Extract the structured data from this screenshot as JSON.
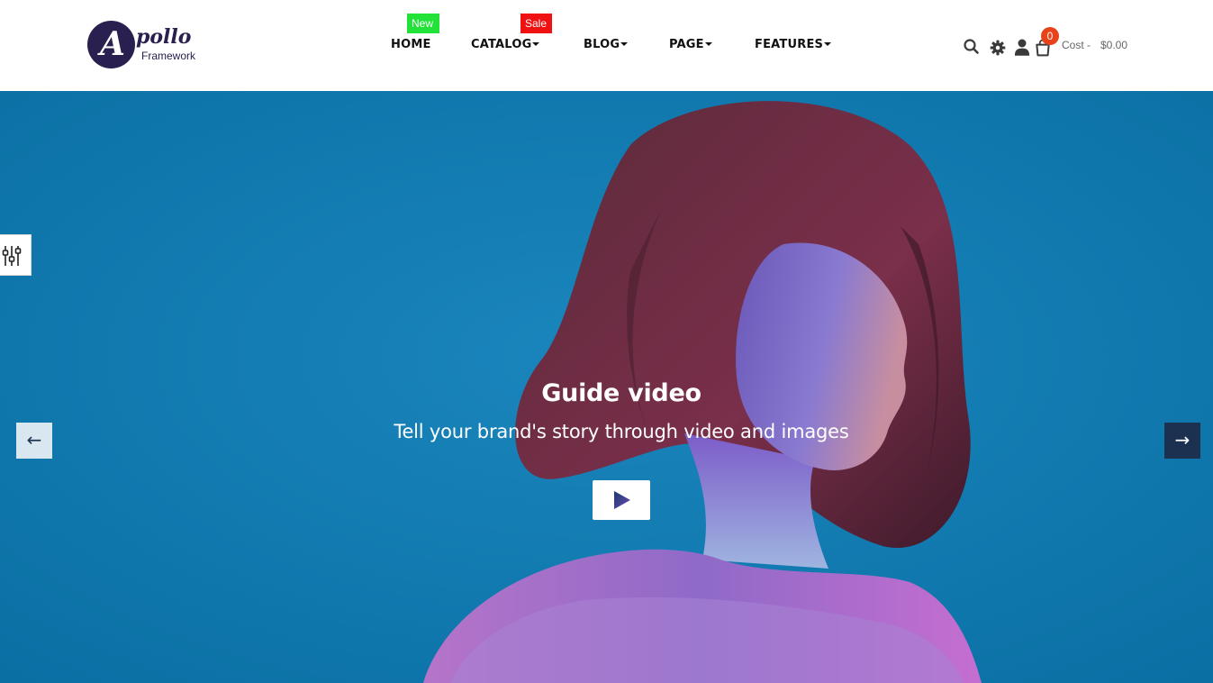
{
  "brand": {
    "logo_initial": "A",
    "logo_word": "pollo",
    "logo_sub": "Framework",
    "color": "#2a2050"
  },
  "nav": {
    "items": [
      {
        "label": "HOME",
        "badge": "New",
        "badge_color": "#22e23a",
        "has_dropdown": false
      },
      {
        "label": "CATALOG",
        "badge": "Sale",
        "badge_color": "#ef1111",
        "has_dropdown": true
      },
      {
        "label": "BLOG",
        "has_dropdown": true
      },
      {
        "label": "PAGE",
        "has_dropdown": true
      },
      {
        "label": "FEATURES",
        "has_dropdown": true
      }
    ]
  },
  "tools": {
    "icons": [
      "search-icon",
      "gear-icon",
      "user-icon",
      "cart-icon"
    ],
    "cart_count": "0",
    "cost_label": "Cost -",
    "cost_value": "$0.00"
  },
  "hero": {
    "title": "Guide video",
    "subtitle": "Tell your brand's story through video and images",
    "background_color": "#0b78ad",
    "prev_arrow": "←",
    "next_arrow": "→",
    "play_icon": "play-icon"
  },
  "side_panel": {
    "icon": "sliders-icon"
  }
}
